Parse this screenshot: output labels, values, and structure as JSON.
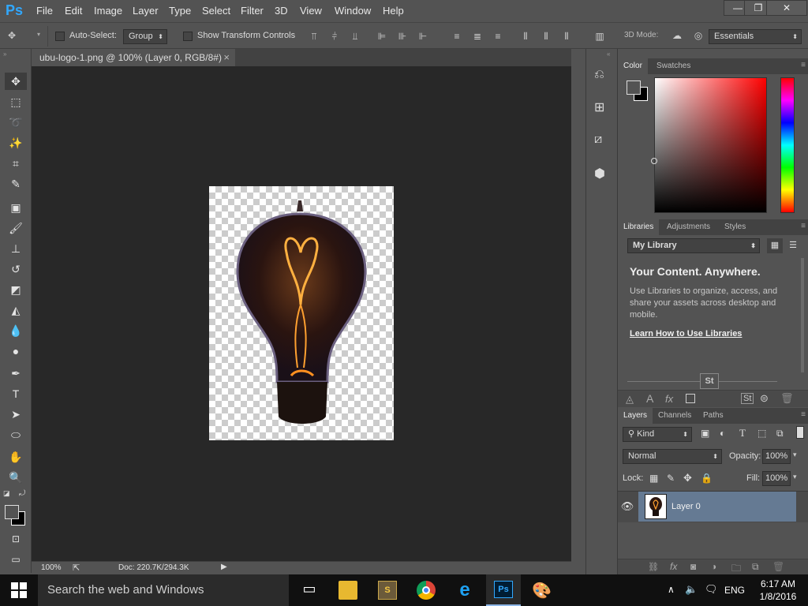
{
  "app": {
    "logo": "Ps",
    "accent": "#31a8ff"
  },
  "menu": [
    "File",
    "Edit",
    "Image",
    "Layer",
    "Type",
    "Select",
    "Filter",
    "3D",
    "View",
    "Window",
    "Help"
  ],
  "window_controls": {
    "minimize": "—",
    "restore": "❐",
    "close": "✕"
  },
  "options_bar": {
    "auto_select_label": "Auto-Select:",
    "auto_select_value": "Group",
    "show_transform_label": "Show Transform Controls",
    "mode_3d_label": "3D Mode:",
    "workspace": "Essentials"
  },
  "document": {
    "tab_title": "ubu-logo-1.png @ 100% (Layer 0, RGB/8#)",
    "close": "×",
    "zoom": "100%",
    "doc_info": "Doc: 220.7K/294.3K"
  },
  "color_panel": {
    "tabs": [
      "Color",
      "Swatches"
    ]
  },
  "libraries_panel": {
    "tabs": [
      "Libraries",
      "Adjustments",
      "Styles"
    ],
    "library_select": "My Library",
    "heading": "Your Content. Anywhere.",
    "body": "Use Libraries to organize, access, and share your assets across desktop and mobile.",
    "link": "Learn How to Use Libraries",
    "stock_badge": "St"
  },
  "layers_panel": {
    "tabs": [
      "Layers",
      "Channels",
      "Paths"
    ],
    "kind_filter": "Kind",
    "blend_mode": "Normal",
    "opacity_label": "Opacity:",
    "opacity_value": "100%",
    "lock_label": "Lock:",
    "fill_label": "Fill:",
    "fill_value": "100%",
    "layers": [
      {
        "name": "Layer 0",
        "visible": true,
        "selected": true
      }
    ]
  },
  "taskbar": {
    "search_placeholder": "Search the web and Windows",
    "language": "ENG",
    "time": "6:17 AM",
    "date": "1/8/2016"
  }
}
